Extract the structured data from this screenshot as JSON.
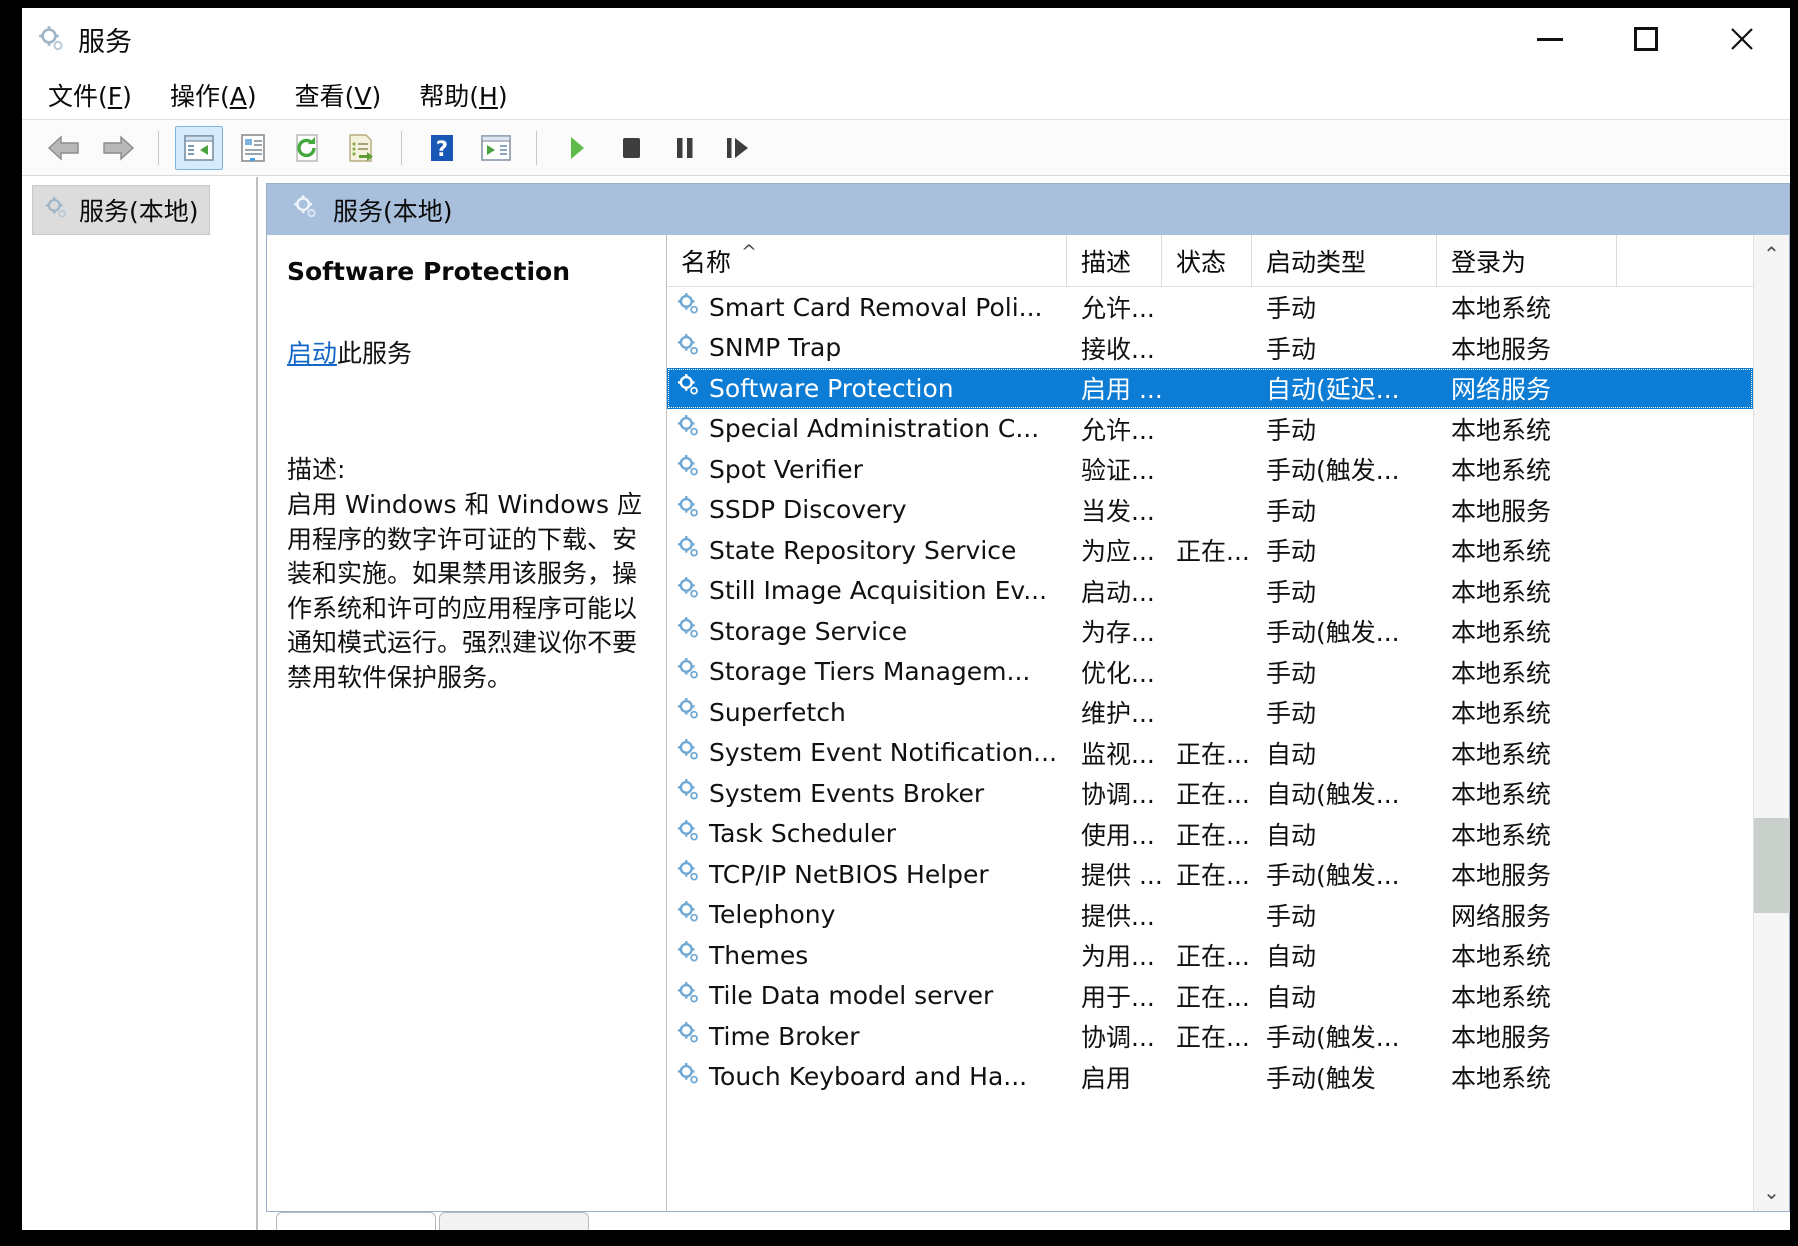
{
  "window": {
    "title": "服务",
    "icon": "services-gear-icon",
    "controls": {
      "minimize": "–",
      "maximize": "□",
      "close": "✕"
    }
  },
  "menubar": [
    {
      "name": "file",
      "label": "文件",
      "accel": "F"
    },
    {
      "name": "action",
      "label": "操作",
      "accel": "A"
    },
    {
      "name": "view",
      "label": "查看",
      "accel": "V"
    },
    {
      "name": "help",
      "label": "帮助",
      "accel": "H"
    }
  ],
  "toolbar": [
    {
      "name": "back-arrow-icon",
      "kind": "icon",
      "active": false
    },
    {
      "name": "forward-arrow-icon",
      "kind": "icon",
      "active": false
    },
    {
      "name": "separator-1",
      "kind": "sep"
    },
    {
      "name": "show-hide-tree-icon",
      "kind": "icon",
      "active": true
    },
    {
      "name": "properties-icon",
      "kind": "icon",
      "active": false
    },
    {
      "name": "refresh-icon",
      "kind": "icon",
      "active": false
    },
    {
      "name": "export-list-icon",
      "kind": "icon",
      "active": false
    },
    {
      "name": "separator-2",
      "kind": "sep"
    },
    {
      "name": "help-icon",
      "kind": "icon",
      "active": false
    },
    {
      "name": "show-action-pane-icon",
      "kind": "icon",
      "active": false
    },
    {
      "name": "separator-3",
      "kind": "sep"
    },
    {
      "name": "start-service-icon",
      "kind": "icon",
      "active": false
    },
    {
      "name": "stop-service-icon",
      "kind": "icon",
      "active": false
    },
    {
      "name": "pause-service-icon",
      "kind": "icon",
      "active": false
    },
    {
      "name": "restart-service-icon",
      "kind": "icon",
      "active": false
    }
  ],
  "tree": {
    "root_label": "服务(本地)"
  },
  "console_header": {
    "label": "服务(本地)"
  },
  "detail": {
    "service_name": "Software Protection",
    "action_link": "启动",
    "action_suffix": "此服务",
    "description_label": "描述:",
    "description": "启用 Windows 和 Windows 应用程序的数字许可证的下载、安装和实施。如果禁用该服务，操作系统和许可的应用程序可能以通知模式运行。强烈建议你不要禁用软件保护服务。"
  },
  "list": {
    "sort_indicator": "^",
    "columns": [
      {
        "name": "name",
        "label": "名称"
      },
      {
        "name": "desc",
        "label": "描述"
      },
      {
        "name": "state",
        "label": "状态"
      },
      {
        "name": "startup",
        "label": "启动类型"
      },
      {
        "name": "logon",
        "label": "登录为"
      }
    ],
    "rows": [
      {
        "name": "Smart Card Removal Poli...",
        "desc": "允许...",
        "state": "",
        "startup": "手动",
        "logon": "本地系统",
        "selected": false
      },
      {
        "name": "SNMP Trap",
        "desc": "接收...",
        "state": "",
        "startup": "手动",
        "logon": "本地服务",
        "selected": false
      },
      {
        "name": "Software Protection",
        "desc": "启用 ...",
        "state": "",
        "startup": "自动(延迟...",
        "logon": "网络服务",
        "selected": true
      },
      {
        "name": "Special Administration C...",
        "desc": "允许...",
        "state": "",
        "startup": "手动",
        "logon": "本地系统",
        "selected": false
      },
      {
        "name": "Spot Verifier",
        "desc": "验证...",
        "state": "",
        "startup": "手动(触发...",
        "logon": "本地系统",
        "selected": false
      },
      {
        "name": "SSDP Discovery",
        "desc": "当发...",
        "state": "",
        "startup": "手动",
        "logon": "本地服务",
        "selected": false
      },
      {
        "name": "State Repository Service",
        "desc": "为应...",
        "state": "正在...",
        "startup": "手动",
        "logon": "本地系统",
        "selected": false
      },
      {
        "name": "Still Image Acquisition Ev...",
        "desc": "启动...",
        "state": "",
        "startup": "手动",
        "logon": "本地系统",
        "selected": false
      },
      {
        "name": "Storage Service",
        "desc": "为存...",
        "state": "",
        "startup": "手动(触发...",
        "logon": "本地系统",
        "selected": false
      },
      {
        "name": "Storage Tiers Managem...",
        "desc": "优化...",
        "state": "",
        "startup": "手动",
        "logon": "本地系统",
        "selected": false
      },
      {
        "name": "Superfetch",
        "desc": "维护...",
        "state": "",
        "startup": "手动",
        "logon": "本地系统",
        "selected": false
      },
      {
        "name": "System Event Notification...",
        "desc": "监视...",
        "state": "正在...",
        "startup": "自动",
        "logon": "本地系统",
        "selected": false
      },
      {
        "name": "System Events Broker",
        "desc": "协调...",
        "state": "正在...",
        "startup": "自动(触发...",
        "logon": "本地系统",
        "selected": false
      },
      {
        "name": "Task Scheduler",
        "desc": "使用...",
        "state": "正在...",
        "startup": "自动",
        "logon": "本地系统",
        "selected": false
      },
      {
        "name": "TCP/IP NetBIOS Helper",
        "desc": "提供 ...",
        "state": "正在...",
        "startup": "手动(触发...",
        "logon": "本地服务",
        "selected": false
      },
      {
        "name": "Telephony",
        "desc": "提供...",
        "state": "",
        "startup": "手动",
        "logon": "网络服务",
        "selected": false
      },
      {
        "name": "Themes",
        "desc": "为用...",
        "state": "正在...",
        "startup": "自动",
        "logon": "本地系统",
        "selected": false
      },
      {
        "name": "Tile Data model server",
        "desc": "用于...",
        "state": "正在...",
        "startup": "自动",
        "logon": "本地系统",
        "selected": false
      },
      {
        "name": "Time Broker",
        "desc": "协调...",
        "state": "正在...",
        "startup": "手动(触发...",
        "logon": "本地服务",
        "selected": false
      },
      {
        "name": "Touch Keyboard and Ha...",
        "desc": "启用",
        "state": "",
        "startup": "手动(触发",
        "logon": "本地系统",
        "selected": false
      }
    ],
    "scrollbar": {
      "up_arrow": "⌃",
      "down_arrow": "⌄"
    }
  },
  "colors": {
    "selection": "#0c7cd5",
    "header_band": "#a9c0dd",
    "link": "#1267c8",
    "toolbar_active": "#d7ebfb"
  }
}
